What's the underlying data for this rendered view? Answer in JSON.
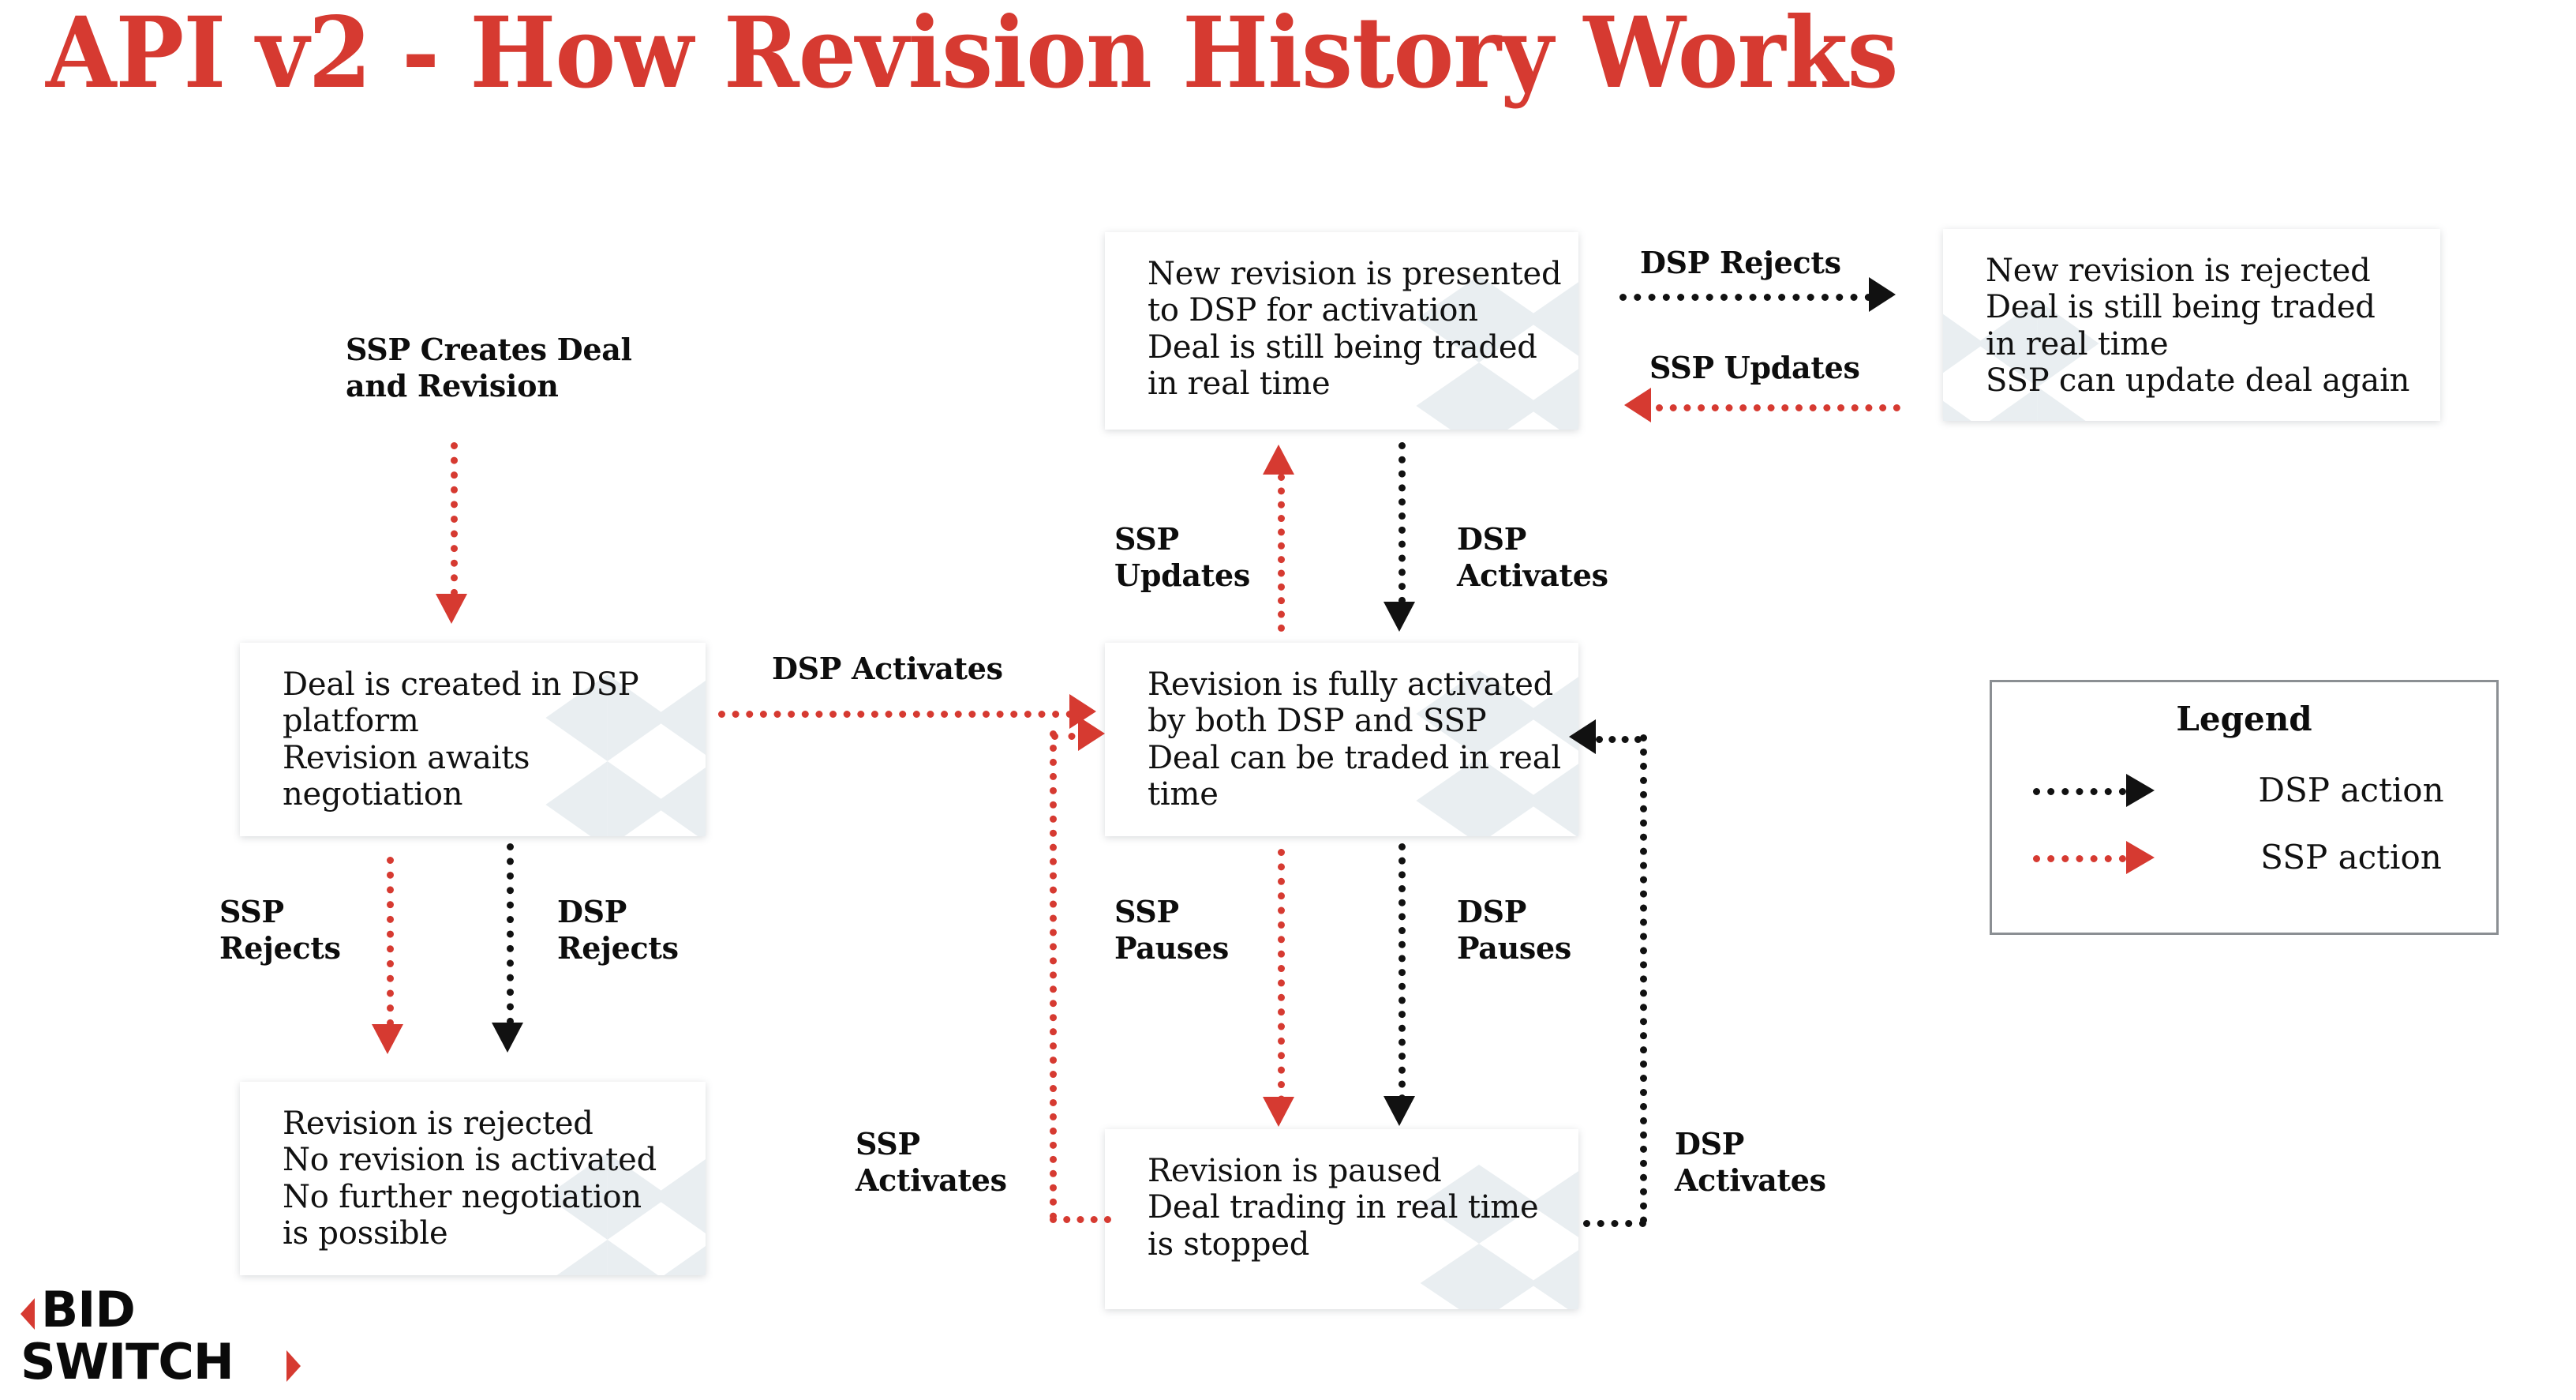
{
  "title": "API v2 - How Revision History Works",
  "colors": {
    "ssp_action": "#d63a31",
    "dsp_action": "#111111",
    "title": "#d63a31",
    "box_background": "#ffffff",
    "watermark": "#e9eef1",
    "legend_border": "#8b8f93"
  },
  "nodes": {
    "deal_created": {
      "lines": [
        "Deal is created in DSP",
        "platform",
        "Revision awaits",
        "negotiation"
      ]
    },
    "revision_rejected": {
      "lines": [
        "Revision is rejected",
        "No revision is activated",
        "No further negotiation",
        "is possible"
      ]
    },
    "new_revision_presented": {
      "lines": [
        "New revision is presented",
        "to DSP for activation",
        "Deal is still being traded",
        "in real time"
      ]
    },
    "revision_activated": {
      "lines": [
        "Revision is fully activated",
        "by both DSP and SSP",
        "Deal can be traded in real",
        "time"
      ]
    },
    "revision_paused": {
      "lines": [
        "Revision is paused",
        "Deal trading in real time",
        "is stopped"
      ]
    },
    "new_revision_rejected": {
      "lines": [
        "New revision is rejected",
        "Deal is still being traded",
        "in real time",
        "SSP can update deal again"
      ]
    }
  },
  "edge_labels": {
    "ssp_creates": {
      "line1": "SSP Creates Deal",
      "line2": "and Revision"
    },
    "ssp_rejects": {
      "line1": "SSP",
      "line2": "Rejects"
    },
    "dsp_rejects_left": {
      "line1": "DSP",
      "line2": "Rejects"
    },
    "dsp_activates_main": {
      "line1": "DSP Activates"
    },
    "ssp_updates_center": {
      "line1": "SSP",
      "line2": "Updates"
    },
    "dsp_activates_center": {
      "line1": "DSP",
      "line2": "Activates"
    },
    "dsp_rejects_top": {
      "line1": "DSP Rejects"
    },
    "ssp_updates_top": {
      "line1": "SSP Updates"
    },
    "ssp_pauses": {
      "line1": "SSP",
      "line2": "Pauses"
    },
    "dsp_pauses": {
      "line1": "DSP",
      "line2": "Pauses"
    },
    "ssp_activates_bottom": {
      "line1": "SSP",
      "line2": "Activates"
    },
    "dsp_activates_bottom": {
      "line1": "DSP",
      "line2": "Activates"
    }
  },
  "legend": {
    "title": "Legend",
    "items": [
      {
        "label": "DSP action",
        "color": "#111111"
      },
      {
        "label": "SSP action",
        "color": "#d63a31"
      }
    ]
  },
  "logo": {
    "line1": "BID",
    "line2": "SWITCH"
  }
}
